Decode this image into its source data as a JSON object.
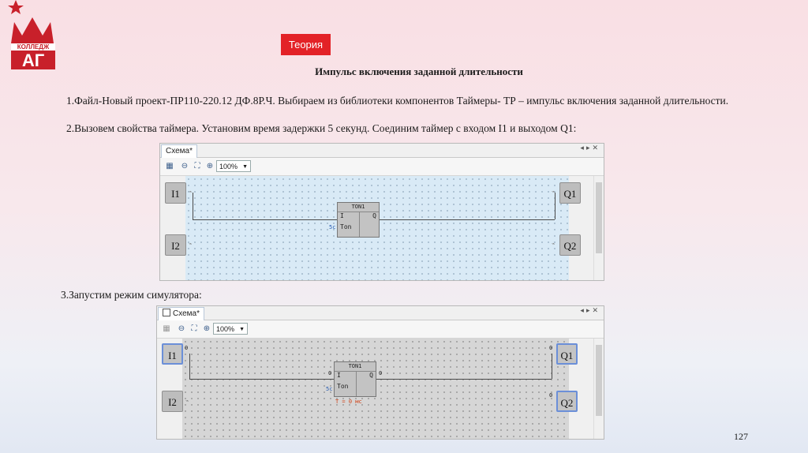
{
  "logo": {
    "text": "КОЛЛЕДЖ",
    "letters": "АГ",
    "color": "#c8202a"
  },
  "tag": {
    "label": "Теория",
    "color": "#e32227"
  },
  "heading": "Импульс включения заданной длительности",
  "paragraphs": [
    "1.Файл-Новый проект-ПР110-220.12 ДФ.8Р.Ч.  Выбираем из библиотеки компонентов Таймеры- ТР – импульс включения заданной длительности.",
    "2.Вызовем свойства таймера. Установим время задержки 5 секунд. Соединим таймер с входом I1 и выходом Q1:",
    "3.Запустим режим симулятора:"
  ],
  "page_number": "127",
  "editor1": {
    "tab": "Схема*",
    "zoom": "100%",
    "inputs": [
      "I1",
      "I2"
    ],
    "outputs": [
      "Q1",
      "Q2"
    ],
    "block": {
      "title": "TON1",
      "in": "I",
      "out": "Q",
      "param": "Ton",
      "param_value": "5c"
    }
  },
  "editor2": {
    "tab": "Схема*",
    "zoom": "100%",
    "inputs": [
      "I1",
      "I2"
    ],
    "outputs": [
      "Q1",
      "Q2"
    ],
    "block": {
      "title": "TON1",
      "in": "I",
      "out": "Q",
      "param": "Ton",
      "param_value": "5c",
      "timer_readout": "T = 0 мс"
    },
    "values": {
      "i1": "0",
      "i2": "0",
      "q1": "0",
      "q2": "0",
      "block_in": "0",
      "block_out": "0"
    }
  },
  "icons": [
    "grid-icon",
    "zoom-out-icon",
    "fit-icon",
    "zoom-in-icon",
    "lock-icon"
  ]
}
